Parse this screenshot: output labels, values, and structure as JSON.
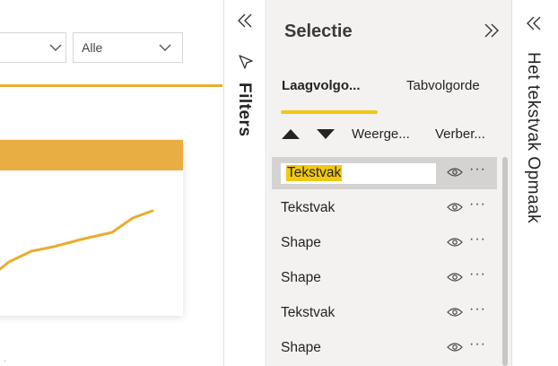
{
  "canvas": {
    "dropdown_1_value": "",
    "dropdown_2_value": "Alle",
    "chart_color": "#e8ad43",
    "line_color": "#e8ad2f"
  },
  "filters_pane": {
    "label": "Filters"
  },
  "selection_pane": {
    "title": "Selectie",
    "tabs": [
      {
        "label": "Laagvolgo...",
        "active": true
      },
      {
        "label": "Tabvolgorde",
        "active": false
      }
    ],
    "columns": {
      "show": "Weerge...",
      "hide": "Verber..."
    },
    "items": [
      {
        "label": "Tekstvak",
        "selected": true,
        "editing": true
      },
      {
        "label": "Tekstvak",
        "selected": false
      },
      {
        "label": "Shape",
        "selected": false
      },
      {
        "label": "Shape",
        "selected": false
      },
      {
        "label": "Tekstvak",
        "selected": false
      },
      {
        "label": "Shape",
        "selected": false
      }
    ],
    "accent_color": "#f2c811"
  },
  "format_pane": {
    "label": "Het tekstvak Opmaak"
  }
}
